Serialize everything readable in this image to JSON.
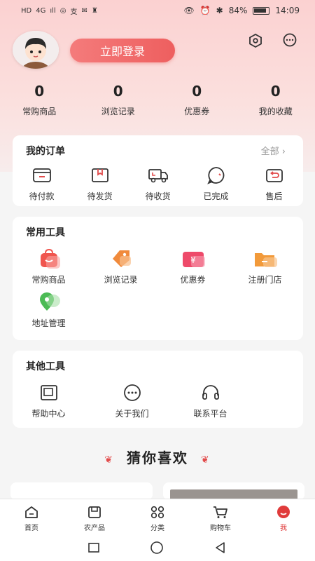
{
  "status_bar": {
    "left": [
      "HD",
      "4G",
      "ıll",
      "◎",
      "支",
      "✉",
      "♜"
    ],
    "battery": "84%",
    "time": "14:09"
  },
  "header": {
    "login_button": "立即登录",
    "settings_icon": "settings-hex-icon",
    "message_icon": "message-icon"
  },
  "stats": [
    {
      "value": "0",
      "label": "常购商品"
    },
    {
      "value": "0",
      "label": "浏览记录"
    },
    {
      "value": "0",
      "label": "优惠券"
    },
    {
      "value": "0",
      "label": "我的收藏"
    }
  ],
  "orders": {
    "title": "我的订单",
    "more": "全部",
    "items": [
      {
        "label": "待付款",
        "icon": "wallet-icon"
      },
      {
        "label": "待发货",
        "icon": "package-icon"
      },
      {
        "label": "待收货",
        "icon": "truck-icon"
      },
      {
        "label": "已完成",
        "icon": "chat-check-icon"
      },
      {
        "label": "售后",
        "icon": "return-icon"
      }
    ]
  },
  "common_tools": {
    "title": "常用工具",
    "items": [
      {
        "label": "常购商品",
        "icon": "bag-icon",
        "color": "#f0554e"
      },
      {
        "label": "浏览记录",
        "icon": "tag-icon",
        "color": "#f08a3c"
      },
      {
        "label": "优惠券",
        "icon": "coupon-icon",
        "color": "#ee4a6a"
      },
      {
        "label": "注册门店",
        "icon": "folder-icon",
        "color": "#f29a3a"
      },
      {
        "label": "地址管理",
        "icon": "location-icon",
        "color": "#4cbb55"
      }
    ]
  },
  "other_tools": {
    "title": "其他工具",
    "items": [
      {
        "label": "帮助中心",
        "icon": "help-box-icon"
      },
      {
        "label": "关于我们",
        "icon": "about-chat-icon"
      },
      {
        "label": "联系平台",
        "icon": "headset-icon"
      }
    ]
  },
  "guess_like": {
    "title": "猜你喜欢"
  },
  "tabbar": [
    {
      "label": "首页",
      "icon": "home-icon",
      "active": false
    },
    {
      "label": "农产品",
      "icon": "box-icon",
      "active": false
    },
    {
      "label": "分类",
      "icon": "category-icon",
      "active": false
    },
    {
      "label": "购物车",
      "icon": "cart-icon",
      "active": false
    },
    {
      "label": "我",
      "icon": "profile-icon",
      "active": true
    }
  ],
  "colors": {
    "accent": "#ee5f5f",
    "active_tab": "#e03b3b"
  }
}
